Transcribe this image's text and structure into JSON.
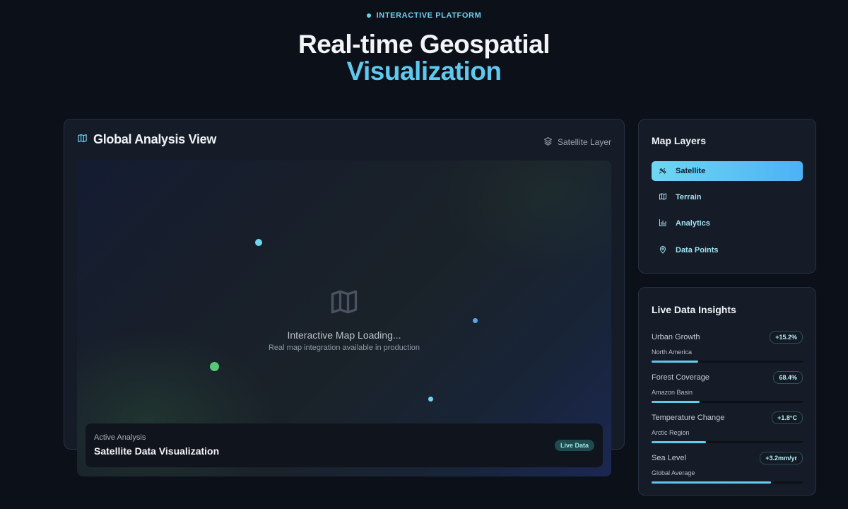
{
  "header": {
    "badge": "INTERACTIVE PLATFORM",
    "title_line1": "Real-time Geospatial",
    "title_line2": "Visualization"
  },
  "map_card": {
    "title": "Global Analysis View",
    "title_icon": "map-icon",
    "layer_chip": {
      "icon": "layers-icon",
      "label": "Satellite Layer"
    },
    "loading_icon": "map-icon",
    "loading_title": "Interactive Map Loading...",
    "loading_subtitle": "Real map integration available in production",
    "analysis": {
      "label": "Active Analysis",
      "title": "Satellite Data Visualization",
      "status": "Live Data"
    }
  },
  "layers_panel": {
    "title": "Map Layers",
    "items": [
      {
        "label": "Satellite",
        "icon": "satellite-icon",
        "active": true
      },
      {
        "label": "Terrain",
        "icon": "map-icon",
        "active": false
      },
      {
        "label": "Analytics",
        "icon": "bar-chart-icon",
        "active": false
      },
      {
        "label": "Data Points",
        "icon": "map-pin-icon",
        "active": false
      }
    ]
  },
  "insights_panel": {
    "title": "Live Data Insights",
    "items": [
      {
        "name": "Urban Growth",
        "region": "North America",
        "value": "+15.2%",
        "progress": 0.31
      },
      {
        "name": "Forest Coverage",
        "region": "Amazon Basin",
        "value": "68.4%",
        "progress": 0.32
      },
      {
        "name": "Temperature Change",
        "region": "Arctic Region",
        "value": "+1.8°C",
        "progress": 0.36
      },
      {
        "name": "Sea Level",
        "region": "Global Average",
        "value": "+3.2mm/yr",
        "progress": 0.79
      }
    ]
  },
  "colors": {
    "accent": "#5fc8ef",
    "background": "#0c1018",
    "card": "#161c27",
    "green_dot": "#55c979",
    "cyan_dot": "#6fd6ef",
    "blue_dot": "#56a9e6"
  }
}
